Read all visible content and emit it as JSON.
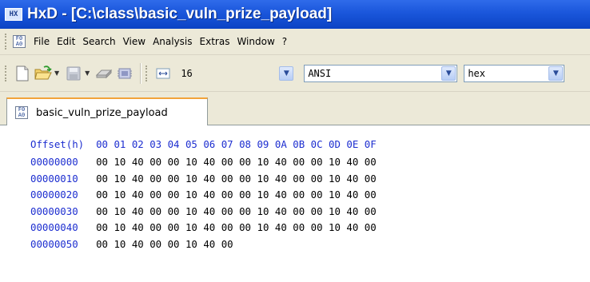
{
  "window": {
    "title": "HxD - [C:\\class\\basic_vuln_prize_payload]",
    "icon_text": "HX"
  },
  "menu": {
    "icon_text": "F0\nA0",
    "items": [
      "File",
      "Edit",
      "Search",
      "View",
      "Analysis",
      "Extras",
      "Window",
      "?"
    ]
  },
  "toolbar": {
    "bytes_per_row": "16",
    "charset": "ANSI",
    "offset_base": "hex"
  },
  "tabs": [
    {
      "label": "basic_vuln_prize_payload",
      "active": true
    }
  ],
  "hex_view": {
    "header_label": "Offset(h)",
    "columns": [
      "00",
      "01",
      "02",
      "03",
      "04",
      "05",
      "06",
      "07",
      "08",
      "09",
      "0A",
      "0B",
      "0C",
      "0D",
      "0E",
      "0F"
    ],
    "rows": [
      {
        "offset": "00000000",
        "bytes": [
          "00",
          "10",
          "40",
          "00",
          "00",
          "10",
          "40",
          "00",
          "00",
          "10",
          "40",
          "00",
          "00",
          "10",
          "40",
          "00"
        ]
      },
      {
        "offset": "00000010",
        "bytes": [
          "00",
          "10",
          "40",
          "00",
          "00",
          "10",
          "40",
          "00",
          "00",
          "10",
          "40",
          "00",
          "00",
          "10",
          "40",
          "00"
        ]
      },
      {
        "offset": "00000020",
        "bytes": [
          "00",
          "10",
          "40",
          "00",
          "00",
          "10",
          "40",
          "00",
          "00",
          "10",
          "40",
          "00",
          "00",
          "10",
          "40",
          "00"
        ]
      },
      {
        "offset": "00000030",
        "bytes": [
          "00",
          "10",
          "40",
          "00",
          "00",
          "10",
          "40",
          "00",
          "00",
          "10",
          "40",
          "00",
          "00",
          "10",
          "40",
          "00"
        ]
      },
      {
        "offset": "00000040",
        "bytes": [
          "00",
          "10",
          "40",
          "00",
          "00",
          "10",
          "40",
          "00",
          "00",
          "10",
          "40",
          "00",
          "00",
          "10",
          "40",
          "00"
        ]
      },
      {
        "offset": "00000050",
        "bytes": [
          "00",
          "10",
          "40",
          "00",
          "00",
          "10",
          "40",
          "00"
        ]
      }
    ]
  },
  "colors": {
    "title_bar": "#1a56db",
    "offset_text": "#1d2ed0",
    "tab_highlight": "#f2a33a",
    "chrome": "#ece9d8"
  }
}
